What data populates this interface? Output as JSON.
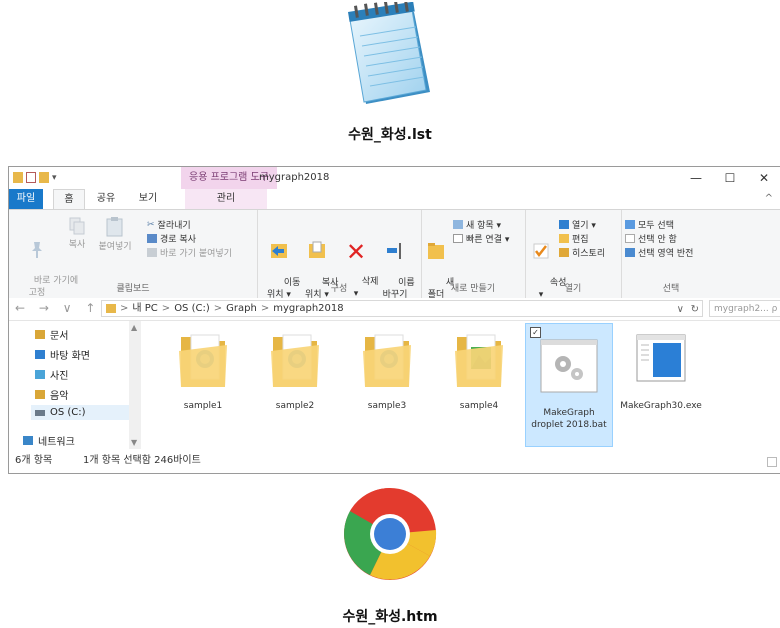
{
  "notepad_caption": "수원_화성.lst",
  "chrome_caption": "수원_화성.htm",
  "window": {
    "title": "mygraph2018",
    "context_tool": "응용 프로그램 도구",
    "tabs": {
      "file": "파일",
      "home": "홈",
      "share": "공유",
      "view": "보기",
      "manage": "관리"
    },
    "controls": {
      "minimize": "—",
      "maximize": "☐",
      "close": "✕"
    },
    "collapse_icon": "^"
  },
  "ribbon": {
    "clipboard": {
      "label": "클립보드",
      "pin": "바로 가기에\n고정",
      "copy": "복사",
      "paste": "붙여넣기",
      "cut": "잘라내기",
      "copy_path": "경로 복사",
      "paste_shortcut": "바로 가기 붙여넣기"
    },
    "organize": {
      "label": "구성",
      "move_to": "이동\n위치 ▾",
      "copy_to": "복사\n위치 ▾",
      "delete": "삭제\n▾",
      "rename": "이름\n바꾸기"
    },
    "new": {
      "label": "새로 만들기",
      "new_folder": "새\n폴더",
      "new_item": "새 항목 ▾",
      "easy_access": "빠른 연결 ▾"
    },
    "open": {
      "label": "열기",
      "properties": "속성\n▾",
      "open": "열기 ▾",
      "edit": "편집",
      "history": "히스토리"
    },
    "select": {
      "label": "선택",
      "select_all": "모두 선택",
      "select_none": "선택 안 함",
      "invert": "선택 영역 반전"
    }
  },
  "address": {
    "nav_arrows": "← → ∨ ↑",
    "crumbs": [
      "내 PC",
      "OS (C:)",
      "Graph",
      "mygraph2018"
    ],
    "separator": ">",
    "search_placeholder": "mygraph2... ρ",
    "dropdown": "∨",
    "refresh": "↻"
  },
  "nav_pane": {
    "items": [
      "문서",
      "바탕 화면",
      "사진",
      "음악",
      "OS (C:)",
      "네트워크"
    ],
    "colors": [
      "#d9a637",
      "#2f7fd0",
      "#4aa4d8",
      "#d9a637",
      "#6a7a8a",
      "#3a86c8"
    ]
  },
  "files": [
    {
      "name": "sample1",
      "type": "folder"
    },
    {
      "name": "sample2",
      "type": "folder"
    },
    {
      "name": "sample3",
      "type": "folder"
    },
    {
      "name": "sample4",
      "type": "folder"
    },
    {
      "name": "MakeGraph droplet 2018.bat",
      "type": "bat",
      "selected": true
    },
    {
      "name": "MakeGraph30.exe",
      "type": "exe"
    }
  ],
  "status": {
    "count": "6개 항목",
    "selection": "1개 항목 선택함 246바이트"
  }
}
